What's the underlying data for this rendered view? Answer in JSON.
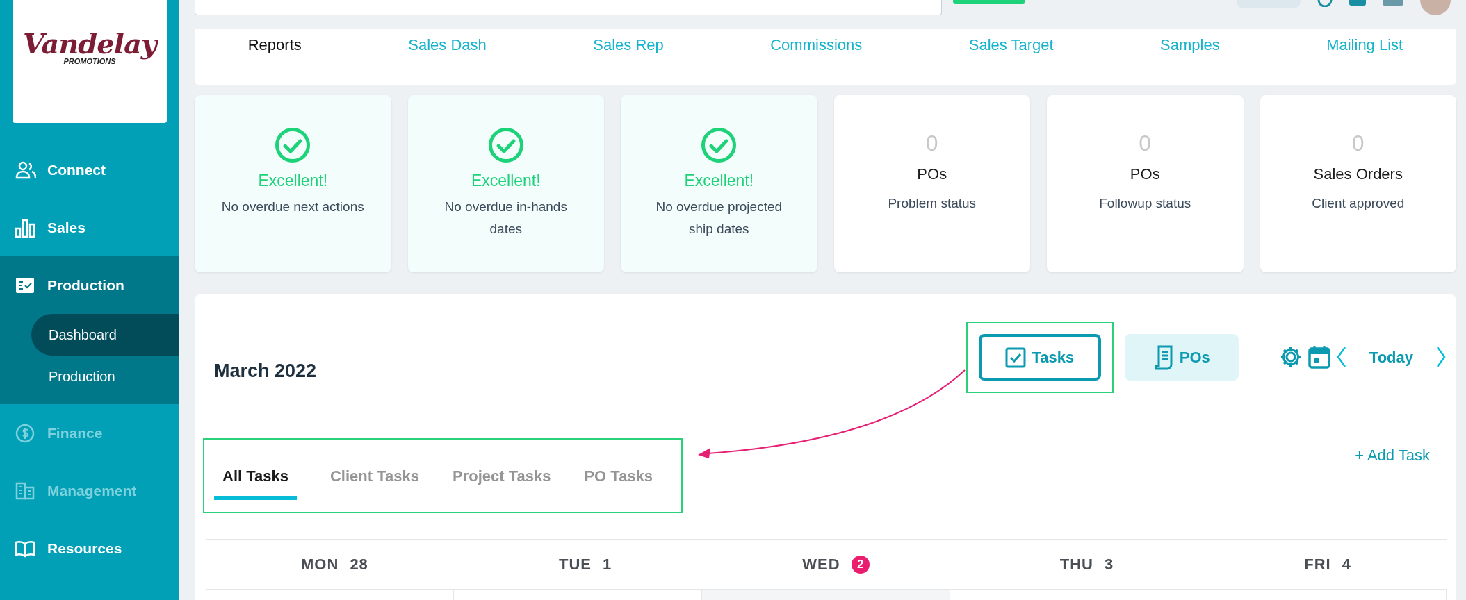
{
  "logo": {
    "name": "Vandelay",
    "tagline": "PROMOTIONS"
  },
  "sidebar": {
    "items": [
      {
        "label": "Connect",
        "disabled": false,
        "expanded": false
      },
      {
        "label": "Sales",
        "disabled": false,
        "expanded": false
      },
      {
        "label": "Production",
        "disabled": false,
        "expanded": true,
        "children": [
          {
            "label": "Dashboard",
            "selected": true
          },
          {
            "label": "Production",
            "selected": false
          }
        ]
      },
      {
        "label": "Finance",
        "disabled": true,
        "expanded": false
      },
      {
        "label": "Management",
        "disabled": true,
        "expanded": false
      },
      {
        "label": "Resources",
        "disabled": false,
        "expanded": false
      }
    ]
  },
  "report_tabs": [
    {
      "label": "Reports",
      "selected": true
    },
    {
      "label": "Sales Dash",
      "selected": false
    },
    {
      "label": "Sales Rep",
      "selected": false
    },
    {
      "label": "Commissions",
      "selected": false
    },
    {
      "label": "Sales Target",
      "selected": false
    },
    {
      "label": "Samples",
      "selected": false
    },
    {
      "label": "Mailing List",
      "selected": false
    }
  ],
  "stat_cards": [
    {
      "kind": "success",
      "title": "Excellent!",
      "text": "No overdue next actions"
    },
    {
      "kind": "success",
      "title": "Excellent!",
      "text": "No overdue in-hands dates"
    },
    {
      "kind": "success",
      "title": "Excellent!",
      "text": "No overdue projected ship dates"
    },
    {
      "kind": "count",
      "count": "0",
      "title": "POs",
      "text": "Problem status"
    },
    {
      "kind": "count",
      "count": "0",
      "title": "POs",
      "text": "Followup status"
    },
    {
      "kind": "count",
      "count": "0",
      "title": "Sales Orders",
      "text": "Client approved"
    }
  ],
  "calendar": {
    "title": "March 2022",
    "view_toggle": [
      {
        "label": "Tasks",
        "selected": true
      },
      {
        "label": "POs",
        "selected": false
      }
    ],
    "today_label": "Today",
    "add_task": "+ Add Task",
    "task_tabs": [
      {
        "label": "All Tasks",
        "selected": true
      },
      {
        "label": "Client Tasks",
        "selected": false
      },
      {
        "label": "Project Tasks",
        "selected": false
      },
      {
        "label": "PO Tasks",
        "selected": false
      }
    ],
    "days": [
      {
        "day": "MON",
        "date": "28",
        "today": false
      },
      {
        "day": "TUE",
        "date": "1",
        "today": false
      },
      {
        "day": "WED",
        "date": "2",
        "today": true
      },
      {
        "day": "THU",
        "date": "3",
        "today": false
      },
      {
        "day": "FRI",
        "date": "4",
        "today": false
      }
    ]
  }
}
